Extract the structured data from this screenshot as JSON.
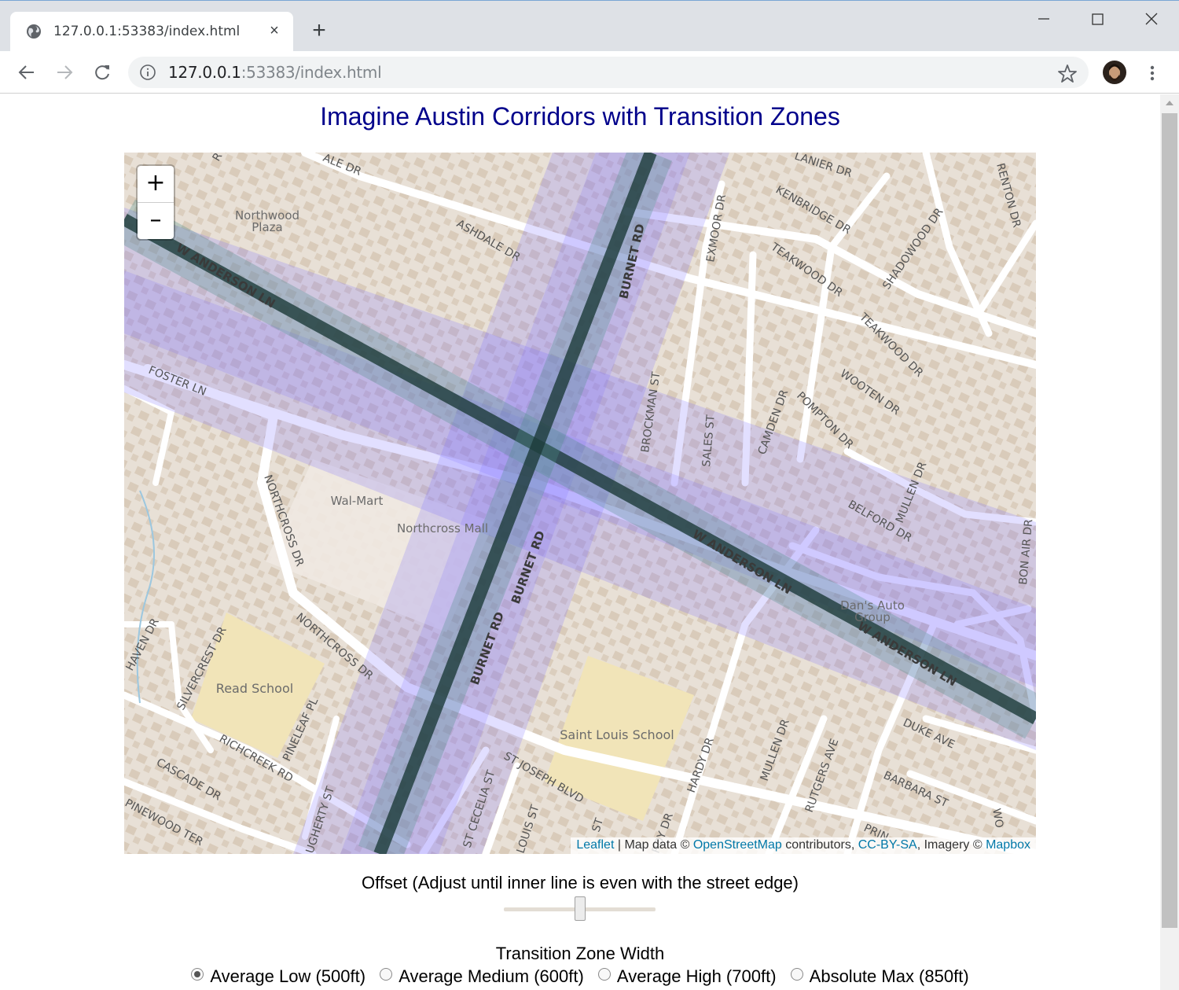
{
  "browser": {
    "tab_title": "127.0.0.1:53383/index.html",
    "tab_close": "×",
    "new_tab": "+",
    "url_host": "127.0.0.1",
    "url_rest": ":53383/index.html"
  },
  "page": {
    "title": "Imagine Austin Corridors with Transition Zones"
  },
  "map": {
    "zoom_in": "+",
    "zoom_out": "–",
    "attribution": {
      "leaflet": "Leaflet",
      "sep1": " | Map data © ",
      "osm": "OpenStreetMap",
      "sep2": " contributors, ",
      "license": "CC-BY-SA",
      "sep3": ", Imagery © ",
      "mapbox": "Mapbox"
    },
    "labels": {
      "northwood_plaza_1": "Northwood",
      "northwood_plaza_2": "Plaza",
      "walmart": "Wal-Mart",
      "northcross_mall": "Northcross Mall",
      "read_school": "Read School",
      "saint_louis_school": "Saint Louis School",
      "dans_auto_1": "Dan's Auto",
      "dans_auto_2": "Group",
      "w_anderson_1": "W ANDERSON LN",
      "w_anderson_2": "W ANDERSON LN",
      "w_anderson_3": "W ANDERSON LN",
      "burnet_1": "BURNET RD",
      "burnet_2": "BURNET RD",
      "burnet_3": "BURNET RD",
      "foster": "FOSTER LN",
      "northcross_dr_1": "NORTHCROSS DR",
      "northcross_dr_2": "NORTHCROSS DR",
      "ashdale": "ASHDALE DR",
      "ale": "ALE DR",
      "lanier": "LANIER DR",
      "kenbridge": "KENBRIDGE DR",
      "teakwood_1": "TEAKWOOD DR",
      "teakwood_2": "TEAKWOOD DR",
      "shadowood": "SHADOWOOD DR",
      "renton": "RENTON DR",
      "exmoor": "EXMOOR DR",
      "brockman": "BROCKMAN ST",
      "sales": "SALES ST",
      "camden": "CAMDEN DR",
      "pompton": "POMPTON DR",
      "wooten": "WOOTEN DR",
      "mullen_1": "MULLEN DR",
      "mullen_2": "MULLEN DR",
      "belford": "BELFORD DR",
      "bon_air": "BON AIR DR",
      "duke": "DUKE AVE",
      "barbara": "BARBARA ST",
      "rutgers": "RUTGERS AVE",
      "hardy_1": "HARDY DR",
      "hardy_2": "RDY DR",
      "st_joseph": "ST JOSEPH BLVD",
      "st_cecelia": "ST CECELIA ST",
      "st_louis": "LOUIS ST",
      "st_short": "ST",
      "silvercrest": "SILVERCREST DR",
      "haven": "HAVEN DR",
      "pineleaf": "PINELEAF PL",
      "richcreek": "RICHCREEK RD",
      "cascade": "CASCADE DR",
      "pinewood": "PINEWOOD TER",
      "ugherty": "UGHERTY ST",
      "prin": "PRIN",
      "wo": "WO",
      "r_top": "R"
    }
  },
  "controls": {
    "offset_label": "Offset (Adjust until inner line is even with the street edge)",
    "offset_value": 0.5,
    "transition_label": "Transition Zone Width",
    "options": [
      {
        "label": "Average Low (500ft)",
        "checked": true
      },
      {
        "label": "Average Medium (600ft)",
        "checked": false
      },
      {
        "label": "Average High (700ft)",
        "checked": false
      },
      {
        "label": "Absolute Max (850ft)",
        "checked": false
      }
    ]
  },
  "colors": {
    "title": "#00008b",
    "corridor_zone": "#7b6cff",
    "corridor_line": "#1d3b3a",
    "link": "#0078a8"
  }
}
